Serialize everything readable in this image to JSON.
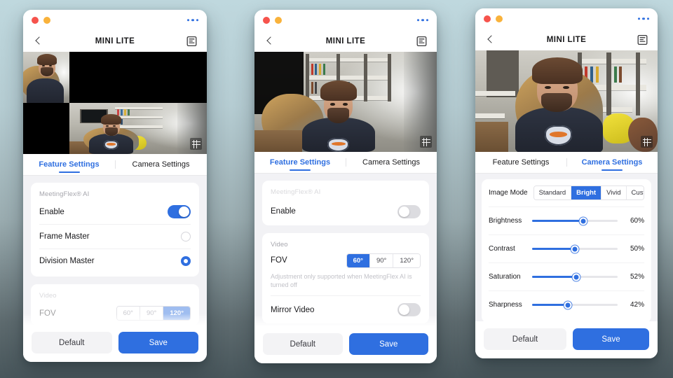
{
  "app": {
    "title": "MINI LITE",
    "window_controls": [
      "close",
      "minimize"
    ],
    "menu_icon": "kebab-menu-icon",
    "back_icon": "back-chevron-icon",
    "doc_icon": "document-icon",
    "video_grid_icon": "grid-overlay-icon",
    "accent_color": "#2f6fe0",
    "muted_accent_color": "#9fbdf0"
  },
  "tabs": {
    "feature": "Feature Settings",
    "camera": "Camera Settings"
  },
  "footer": {
    "default_label": "Default",
    "save_label": "Save"
  },
  "panel1": {
    "active_tab": "Feature Settings",
    "section_ai": "MeetingFlex® AI",
    "enable_label": "Enable",
    "enable_state": "on",
    "frame_master_label": "Frame Master",
    "frame_master_state": "unselected",
    "division_master_label": "Division Master",
    "division_master_state": "selected",
    "section_video": "Video",
    "fov_label": "FOV",
    "fov_options": [
      "60°",
      "90°",
      "120°"
    ],
    "fov_selected": "120°",
    "fov_disabled": true
  },
  "panel2": {
    "active_tab": "Feature Settings",
    "section_ai": "MeetingFlex® AI",
    "enable_label": "Enable",
    "enable_state": "off",
    "section_video": "Video",
    "fov_label": "FOV",
    "fov_options": [
      "60°",
      "90°",
      "120°"
    ],
    "fov_selected": "60°",
    "fov_hint": "Adjustment only supported when MeetingFlex AI is turned off",
    "mirror_label": "Mirror Video",
    "mirror_state": "off"
  },
  "panel3": {
    "active_tab": "Camera Settings",
    "image_mode_label": "Image Mode",
    "image_mode_options": [
      "Standard",
      "Bright",
      "Vivid",
      "Custom"
    ],
    "image_mode_selected": "Bright",
    "sliders": [
      {
        "name": "Brightness",
        "value": 60,
        "display": "60%"
      },
      {
        "name": "Contrast",
        "value": 50,
        "display": "50%"
      },
      {
        "name": "Saturation",
        "value": 52,
        "display": "52%"
      },
      {
        "name": "Sharpness",
        "value": 42,
        "display": "42%"
      }
    ]
  }
}
